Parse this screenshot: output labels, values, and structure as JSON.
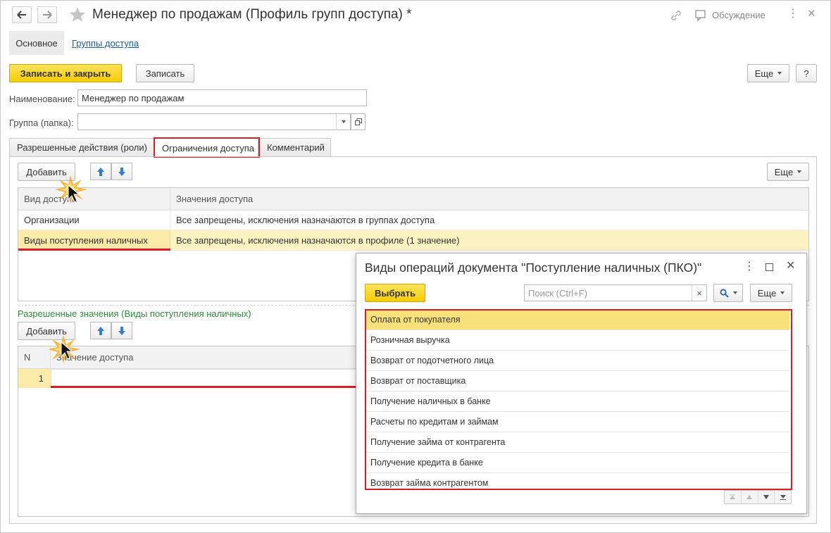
{
  "window": {
    "title": "Менеджер по продажам (Профиль групп доступа) *",
    "discussion_label": "Обсуждение"
  },
  "nav": {
    "main_label": "Основное",
    "access_groups_link": "Группы доступа"
  },
  "toolbar": {
    "save_close_label": "Записать и закрыть",
    "save_label": "Записать",
    "more_label": "Еще",
    "help_label": "?"
  },
  "form": {
    "name_label": "Наименование:",
    "name_value": "Менеджер по продажам",
    "group_label": "Группа (папка):",
    "group_value": ""
  },
  "tabs": [
    {
      "label": "Разрешенные действия (роли)"
    },
    {
      "label": "Ограничения доступа"
    },
    {
      "label": "Комментарий"
    }
  ],
  "restrictions": {
    "add_label": "Добавить",
    "more_label": "Еще",
    "columns": [
      "Вид доступа",
      "Значения доступа"
    ],
    "rows": [
      {
        "kind": "Организации",
        "value": "Все запрещены, исключения назначаются в группах доступа"
      },
      {
        "kind": "Виды поступления наличных",
        "value": "Все запрещены, исключения назначаются в профиле (1 значение)"
      }
    ]
  },
  "allowed": {
    "title": "Разрешенные значения (Виды поступления наличных)",
    "add_label": "Добавить",
    "columns": [
      "N",
      "Значение доступа"
    ],
    "rows": [
      {
        "n": "1",
        "value": ""
      }
    ]
  },
  "popup": {
    "title": "Виды операций документа \"Поступление наличных (ПКО)\"",
    "select_label": "Выбрать",
    "search_placeholder": "Поиск (Ctrl+F)",
    "clear_label": "×",
    "more_label": "Еще",
    "items": [
      "Оплата от покупателя",
      "Розничная выручка",
      "Возврат от подотчетного лица",
      "Возврат от поставщика",
      "Получение наличных в банке",
      "Расчеты по кредитам и займам",
      "Получение займа от контрагента",
      "Получение кредита в банке",
      "Возврат займа контрагентом"
    ],
    "selected_index": 0
  },
  "colors": {
    "accent_yellow": "#f5cc05",
    "highlight_red": "#d61f26",
    "selected_row": "#f8e07a",
    "link_blue": "#1d5ba8",
    "section_green": "#2e8b3a"
  }
}
